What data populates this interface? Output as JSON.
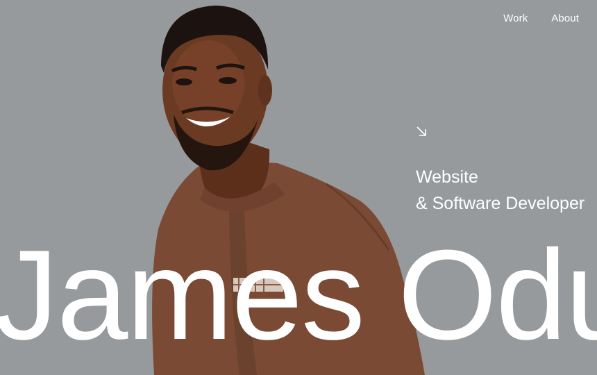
{
  "nav": {
    "links": [
      "Work",
      "About"
    ]
  },
  "hero": {
    "arrow_icon": "arrow-down-right-icon",
    "role_line1": "Website",
    "role_line2": "& Software Developer",
    "name": "James Odu"
  },
  "colors": {
    "background": "#969a9c",
    "text": "#ffffff",
    "shirt": "#7a4a35",
    "skin": "#6b3a22"
  }
}
